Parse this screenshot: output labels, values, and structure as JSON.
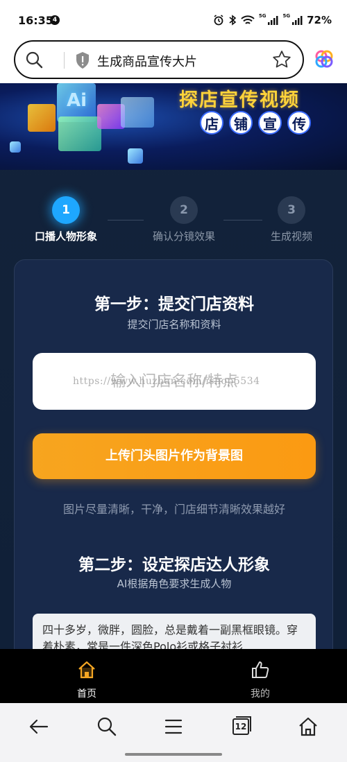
{
  "status_bar": {
    "time": "16:35",
    "notification_count": "4",
    "network_tag_1": "5G",
    "network_tag_2": "5G",
    "battery": "72%"
  },
  "address_bar": {
    "text": "生成商品宣传大片"
  },
  "banner": {
    "ai_text": "Ai",
    "title": "探店宣传视频",
    "subtitle_chars": [
      "店",
      "铺",
      "宣",
      "传"
    ]
  },
  "steps": [
    {
      "number": "1",
      "label": "口播人物形象",
      "active": true
    },
    {
      "number": "2",
      "label": "确认分镜效果",
      "active": false
    },
    {
      "number": "3",
      "label": "生成视频",
      "active": false
    }
  ],
  "step_one": {
    "title": "第一步：提交门店资料",
    "subtitle": "提交门店名称和资料",
    "input_placeholder": "输入门店名称/特点",
    "watermark": "https://www.huzhan.com/ishop5534",
    "upload_button": "上传门头图片作为背景图",
    "tip": "图片尽量清晰，干净，门店细节清晰效果越好"
  },
  "step_two": {
    "title": "第二步：设定探店达人形象",
    "subtitle": "AI根据角色要求生成人物",
    "persona_text": "四十多岁，微胖，圆脸，总是戴着一副黑框眼镜。穿着朴素，常是一件深色Polo衫或格子衬衫"
  },
  "web_tabbar": [
    {
      "label": "首页",
      "icon": "home-icon",
      "active": true
    },
    {
      "label": "我的",
      "icon": "thumbs-up-icon",
      "active": false
    }
  ],
  "browser_toolbar": {
    "tab_count": "12",
    "icons": [
      "back-arrow-icon",
      "search-icon",
      "menu-icon",
      "tabs-icon",
      "home-icon"
    ]
  },
  "colors": {
    "accent_blue": "#1ea7ff",
    "button_orange": "#fb9a12",
    "banner_yellow": "#ffd33a",
    "tab_active": "#f5a623"
  }
}
